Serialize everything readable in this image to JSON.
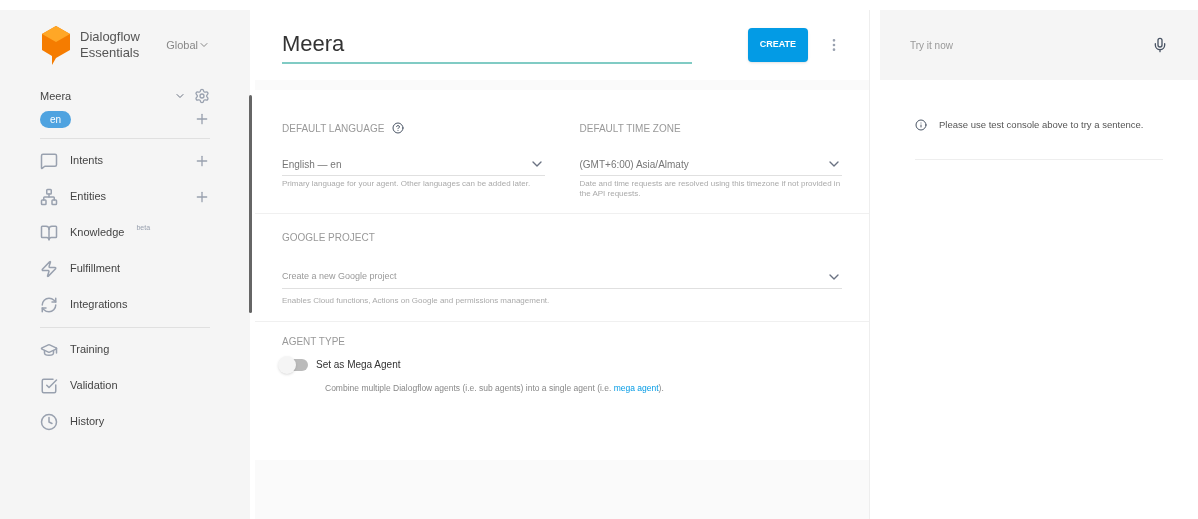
{
  "brand": {
    "line1": "Dialogflow",
    "line2": "Essentials",
    "region": "Global"
  },
  "agent": {
    "name": "Meera",
    "language_chip": "en"
  },
  "nav_groups": [
    [
      {
        "kind": "intents",
        "label": "Intents",
        "add": true
      },
      {
        "kind": "entities",
        "label": "Entities",
        "add": true
      },
      {
        "kind": "knowledge",
        "label": "Knowledge",
        "badge": "beta",
        "add": false
      },
      {
        "kind": "fulfillment",
        "label": "Fulfillment",
        "add": false
      },
      {
        "kind": "integrations",
        "label": "Integrations",
        "add": false
      }
    ],
    [
      {
        "kind": "training",
        "label": "Training",
        "add": false
      },
      {
        "kind": "validation",
        "label": "Validation",
        "add": false
      },
      {
        "kind": "history",
        "label": "History",
        "add": false
      }
    ]
  ],
  "header": {
    "agent_name": "Meera",
    "create_button": "CREATE"
  },
  "language": {
    "label": "DEFAULT LANGUAGE",
    "value": "English — en",
    "hint": "Primary language for your agent. Other languages can be added later."
  },
  "timezone": {
    "label": "DEFAULT TIME ZONE",
    "value": "(GMT+6:00) Asia/Almaty",
    "hint": "Date and time requests are resolved using this timezone if not provided in the API requests."
  },
  "google_project": {
    "label": "GOOGLE PROJECT",
    "placeholder": "Create a new Google project",
    "hint": "Enables Cloud functions, Actions on Google and permissions management."
  },
  "agent_type": {
    "label": "AGENT TYPE",
    "toggle_label": "Set as Mega Agent",
    "on": false,
    "description": "Combine multiple Dialogflow agents (i.e. sub agents) into a single agent (i.e. ",
    "link": "mega agent",
    "tail": ")."
  },
  "console": {
    "placeholder": "Try it now",
    "message": "Please use test console above to try a sentence."
  }
}
